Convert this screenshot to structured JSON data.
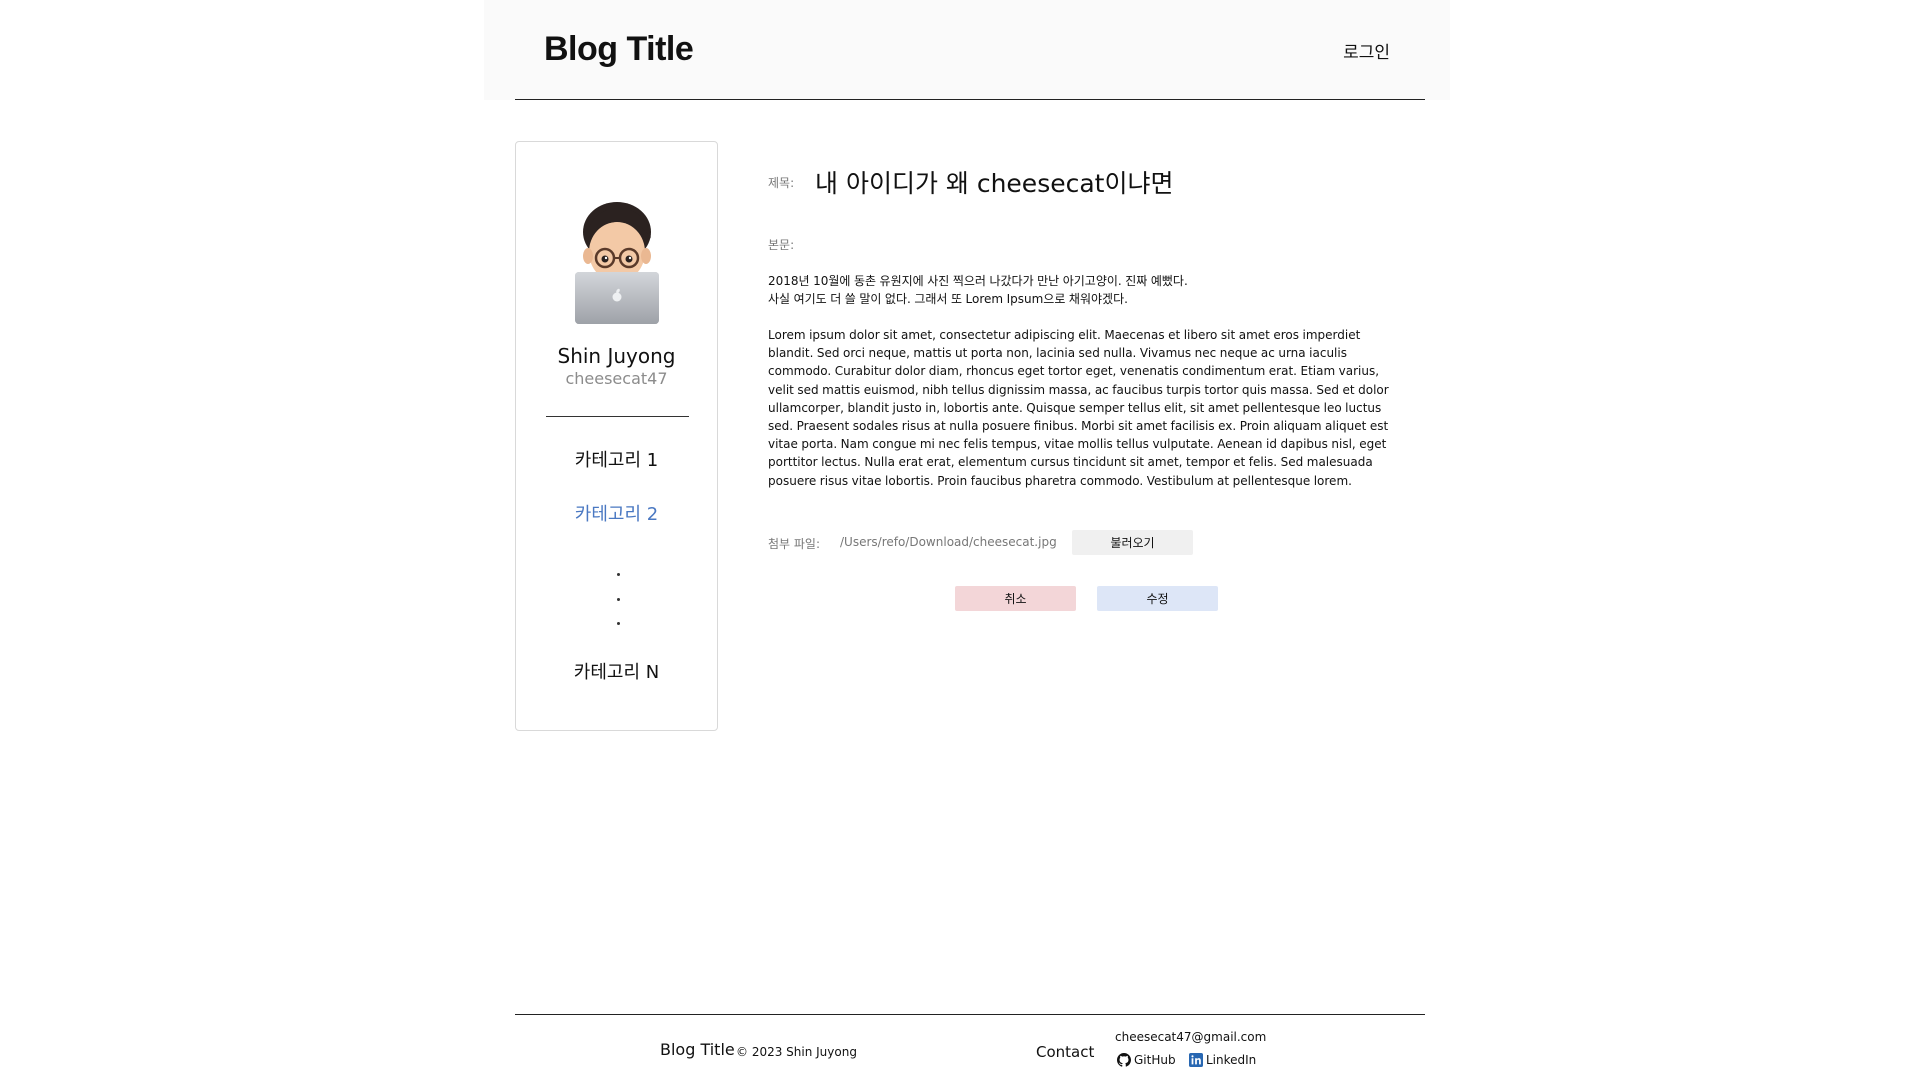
{
  "header": {
    "title": "Blog Title",
    "login_label": "로그인"
  },
  "profile": {
    "name": "Shin Juyong",
    "id": "cheesecat47"
  },
  "sidebar": {
    "categories": [
      {
        "label": "카테고리 1",
        "active": false
      },
      {
        "label": "카테고리 2",
        "active": true
      },
      {
        "label": "카테고리 N",
        "active": false
      }
    ],
    "ellipsis": "·"
  },
  "post": {
    "title_label": "제목:",
    "title": "내 아이디가 왜 cheesecat이냐면",
    "body_label": "본문:",
    "body_paragraph_1": "2018년 10월에 동촌 유원지에 사진 찍으러 나갔다가 만난 아기고양이. 진짜 예뻤다.\n사실 여기도 더 쓸 말이 없다. 그래서 또 Lorem Ipsum으로 채워야겠다.",
    "body_paragraph_2": "Lorem ipsum dolor sit amet, consectetur adipiscing elit. Maecenas et libero sit amet eros imperdiet blandit. Sed orci neque, mattis ut porta non, lacinia sed nulla. Vivamus nec neque ac urna iaculis commodo. Curabitur dolor diam, rhoncus eget tortor eget, venenatis condimentum erat. Etiam varius, velit sed mattis euismod, nibh tellus dignissim massa, ac faucibus turpis tortor quis massa. Sed et dolor ullamcorper, blandit justo in, lobortis ante. Quisque semper tellus elit, sit amet pellentesque leo luctus sed. Praesent sodales risus at nulla posuere finibus. Morbi sit amet facilisis ex. Proin aliquam aliquet est vitae porta. Nam congue mi nec felis tempus, vitae mollis tellus vulputate. Aenean id dapibus nisl, eget porttitor lectus. Nulla erat erat, elementum cursus tincidunt sit amet, tempor et felis. Sed malesuada posuere risus vitae lobortis. Proin faucibus pharetra commodo. Vestibulum at pellentesque lorem.",
    "attach_label": "첨부 파일:",
    "attach_path": "/Users/refo/Download/cheesecat.jpg",
    "load_label": "불러오기",
    "cancel_label": "취소",
    "edit_label": "수정"
  },
  "footer": {
    "title": "Blog Title",
    "copyright": "© 2023 Shin Juyong",
    "contact_label": "Contact",
    "email": "cheesecat47@gmail.com",
    "github_label": "GitHub",
    "linkedin_label": "LinkedIn"
  },
  "colors": {
    "accent_category": "#4a78c2",
    "cancel_bg": "#f3d6d8",
    "edit_bg": "#dde6f7",
    "load_bg": "#f0f0f0",
    "linkedin_blue": "#2867b2"
  },
  "icons": {
    "avatar": "memoji-avatar-with-laptop",
    "github": "github-icon",
    "linkedin": "linkedin-icon"
  }
}
